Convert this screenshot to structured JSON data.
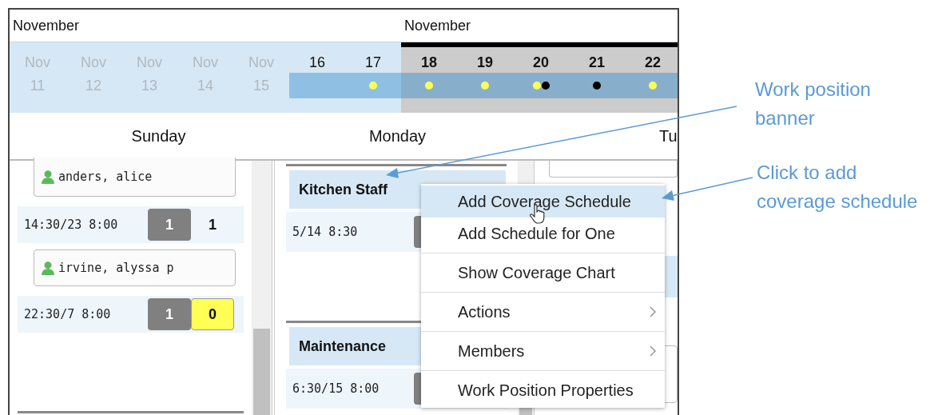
{
  "months": [
    {
      "label": "November"
    },
    {
      "label": "November"
    }
  ],
  "dates": [
    {
      "kind": "outside",
      "month": "Nov",
      "day": "11"
    },
    {
      "kind": "outside",
      "month": "Nov",
      "day": "12"
    },
    {
      "kind": "outside",
      "month": "Nov",
      "day": "13"
    },
    {
      "kind": "outside",
      "month": "Nov",
      "day": "14"
    },
    {
      "kind": "outside",
      "month": "Nov",
      "day": "15"
    },
    {
      "kind": "range",
      "day": "16"
    },
    {
      "kind": "range",
      "day": "17",
      "dots": [
        {
          "color": "#ffff55"
        }
      ]
    },
    {
      "kind": "week",
      "day": "18",
      "dots": [
        {
          "color": "#ffff55"
        }
      ]
    },
    {
      "kind": "week",
      "day": "19",
      "dots": [
        {
          "color": "#ffff55"
        }
      ]
    },
    {
      "kind": "week",
      "day": "20",
      "dots": [
        {
          "color": "#ffff55"
        },
        {
          "color": "#000000"
        }
      ]
    },
    {
      "kind": "week",
      "day": "21",
      "dots": [
        {
          "color": "#000000"
        }
      ]
    },
    {
      "kind": "week",
      "day": "22",
      "dots": [
        {
          "color": "#ffff55"
        }
      ]
    }
  ],
  "day_headers": [
    "Sunday",
    "Monday",
    "Tu"
  ],
  "sunday": [
    {
      "kind": "member",
      "name": "anders, alice"
    },
    {
      "kind": "shift",
      "time": "14:30/23 8:00",
      "counts": [
        {
          "kind": "required",
          "text": "1"
        },
        {
          "kind": "plain",
          "text": "1"
        }
      ]
    },
    {
      "kind": "member",
      "name": "irvine, alyssa p"
    },
    {
      "kind": "shift",
      "time": "22:30/7 8:00",
      "counts": [
        {
          "kind": "required",
          "text": "1"
        },
        {
          "kind": "short",
          "text": "0"
        }
      ]
    }
  ],
  "monday": [
    {
      "banner": "Kitchen Staff",
      "shift": "5/14 8:30"
    },
    {
      "banner": "Maintenance",
      "shift": "6:30/15 8:00"
    }
  ],
  "context_menu": [
    {
      "label": "Add Coverage Schedule",
      "selected": true,
      "submenu": false
    },
    {
      "label": "Add Schedule for One",
      "selected": false,
      "submenu": false
    },
    {
      "label": "Show Coverage Chart",
      "selected": false,
      "submenu": false
    },
    {
      "label": "Actions",
      "selected": false,
      "submenu": true
    },
    {
      "label": "Members",
      "selected": false,
      "submenu": true
    },
    {
      "label": "Work Position Properties",
      "selected": false,
      "submenu": false
    }
  ],
  "annotations": [
    {
      "text": "Work position banner"
    },
    {
      "text": "Click to add coverage schedule"
    }
  ]
}
